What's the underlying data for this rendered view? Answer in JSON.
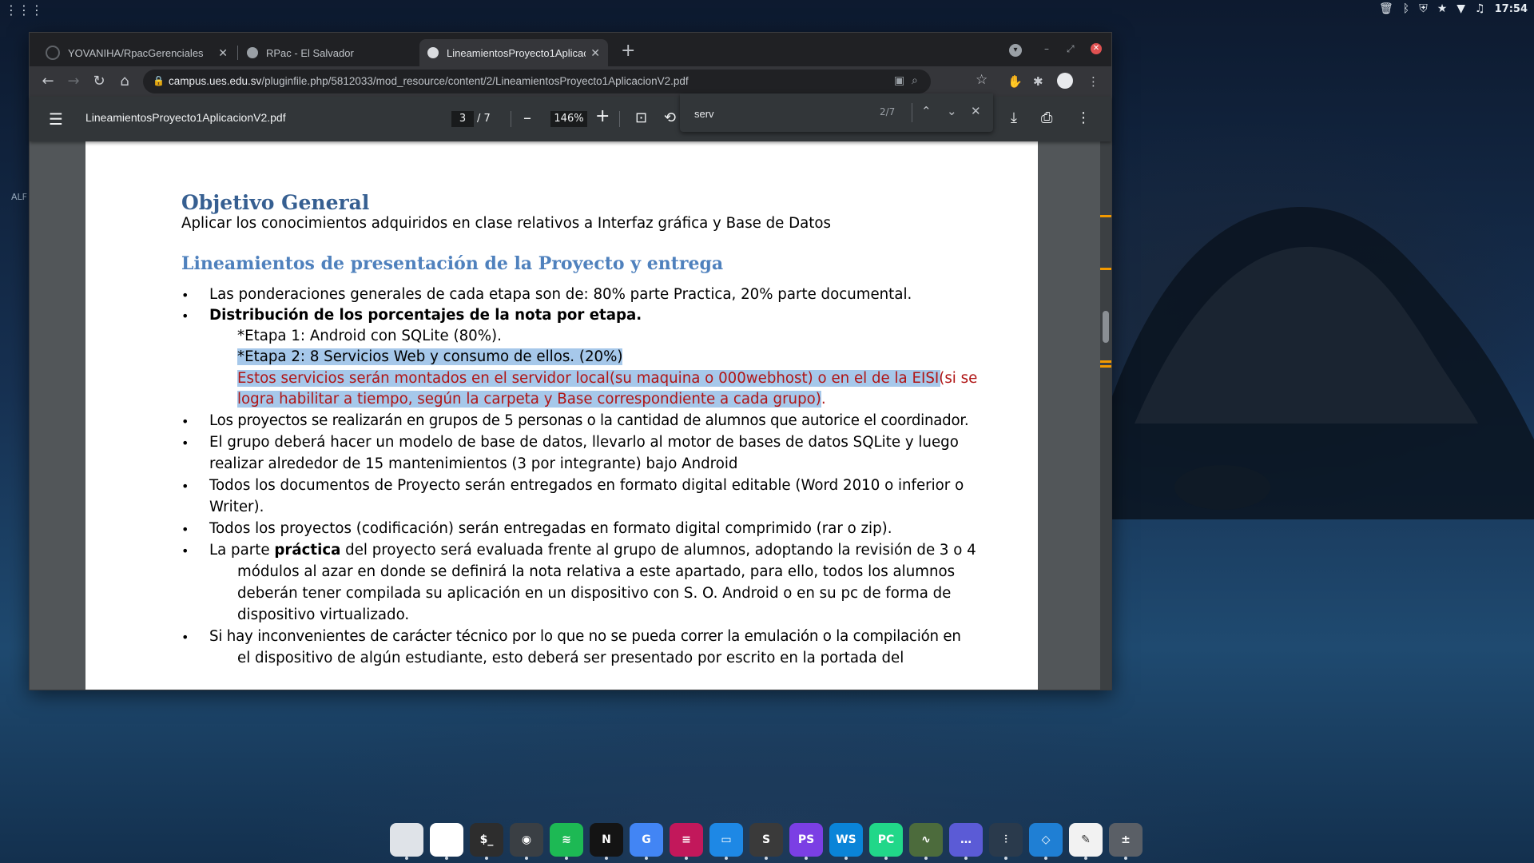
{
  "desktop": {
    "clock": "17:54",
    "side_label": "ALF"
  },
  "browser": {
    "tabs": [
      {
        "label": "YOVANIHA/RpacGerenciales",
        "active": false
      },
      {
        "label": "RPac - El Salvador",
        "active": false
      },
      {
        "label": "LineamientosProyecto1AplicacionV2.pdf",
        "active": true
      }
    ],
    "url_host": "campus.ues.edu.sv",
    "url_path": "/pluginfile.php/5812033/mod_resource/content/2/LineamientosProyecto1AplicacionV2.pdf"
  },
  "pdf_viewer": {
    "title": "LineamientosProyecto1AplicacionV2.pdf",
    "current_page": "3",
    "page_separator": "/  7",
    "zoom": "146%"
  },
  "find_bar": {
    "query": "serv",
    "count": "2/7"
  },
  "document": {
    "heading_1": "Objetivo General",
    "objective_text": "Aplicar los conocimientos adquiridos en clase relativos a Interfaz gráfica y Base de Datos",
    "heading_2": "Lineamientos de presentación de la Proyecto y entrega",
    "bullet_1": "Las ponderaciones generales de cada etapa son de: 80% parte Practica, 20% parte documental.",
    "bullet_2": "Distribución de los porcentajes de la nota por etapa.",
    "etapa_1": "*Etapa 1: Android con SQLite (80%).",
    "etapa_2": "*Etapa 2: 8 Servicios Web y consumo de ellos. (20%)",
    "red_line_1": "Estos servicios serán montados en el servidor local(su maquina o 000webhost) o en el de la EISI(si se",
    "red_line_2": "logra habilitar a tiempo, según la carpeta y Base correspondiente a cada grupo)",
    "red_line_2_end": ".",
    "bullet_3": "Los proyectos se realizarán en grupos de 5 personas o la cantidad de alumnos que autorice el coordinador.",
    "bullet_4_l1": "El grupo deberá hacer un modelo de base de datos, llevarlo al motor de bases de datos SQLite y luego",
    "bullet_4_l2": "realizar alrededor de 15 mantenimientos (3 por integrante) bajo Android",
    "bullet_5_l1": "Todos los documentos de Proyecto serán entregados en formato digital editable (Word 2010 o inferior o",
    "bullet_5_l2": "Writer).",
    "bullet_6": "Todos los proyectos (codificación) serán entregadas en formato digital comprimido (rar o zip).",
    "bullet_7_pre": "La parte ",
    "bullet_7_bold": "práctica",
    "bullet_7_post": " del proyecto será evaluada frente al grupo de alumnos, adoptando la revisión de 3 o 4",
    "bullet_7_l2": "módulos al azar en donde se definirá la nota relativa a este apartado, para ello, todos los alumnos",
    "bullet_7_l3": "deberán tener compilada su aplicación en un dispositivo con S. O. Android o en su pc de forma de",
    "bullet_7_l4": "dispositivo virtualizado.",
    "bullet_8_l1": "Si hay inconvenientes de carácter técnico por lo que no se pueda correr la emulación o la compilación en",
    "bullet_8_l2": "el dispositivo de algún estudiante, esto deberá ser presentado por escrito en la portada del",
    "bullet_symbol": "•"
  },
  "dock": {
    "apps": [
      {
        "name": "files",
        "glyph": "",
        "color": "#dfe3e8"
      },
      {
        "name": "chrome",
        "glyph": "",
        "color": "#ffffff"
      },
      {
        "name": "terminal",
        "glyph": "$_",
        "color": "#2d2d2d"
      },
      {
        "name": "screenshot",
        "glyph": "◉",
        "color": "#3a3f44"
      },
      {
        "name": "spotify",
        "glyph": "≋",
        "color": "#1db954"
      },
      {
        "name": "netflix",
        "glyph": "N",
        "color": "#141414"
      },
      {
        "name": "translate",
        "glyph": "G",
        "color": "#4285f4"
      },
      {
        "name": "notes",
        "glyph": "≡",
        "color": "#c2185b"
      },
      {
        "name": "document",
        "glyph": "▭",
        "color": "#1e88e5"
      },
      {
        "name": "sublime",
        "glyph": "S",
        "color": "#3a3a3a"
      },
      {
        "name": "phpstorm",
        "glyph": "PS",
        "color": "#7b3fe4"
      },
      {
        "name": "webstorm",
        "glyph": "WS",
        "color": "#0a84d8"
      },
      {
        "name": "pycharm",
        "glyph": "PC",
        "color": "#21d789"
      },
      {
        "name": "monitor",
        "glyph": "∿",
        "color": "#4c6b3c"
      },
      {
        "name": "terminal-2",
        "glyph": "…",
        "color": "#5b5bd6"
      },
      {
        "name": "equalizer",
        "glyph": "⫶",
        "color": "#2a3a4c"
      },
      {
        "name": "vscode",
        "glyph": "◇",
        "color": "#1f7fd4"
      },
      {
        "name": "text-editor",
        "glyph": "✎",
        "color": "#f2f2f2"
      },
      {
        "name": "calculator",
        "glyph": "±",
        "color": "#5a5f66"
      }
    ]
  }
}
